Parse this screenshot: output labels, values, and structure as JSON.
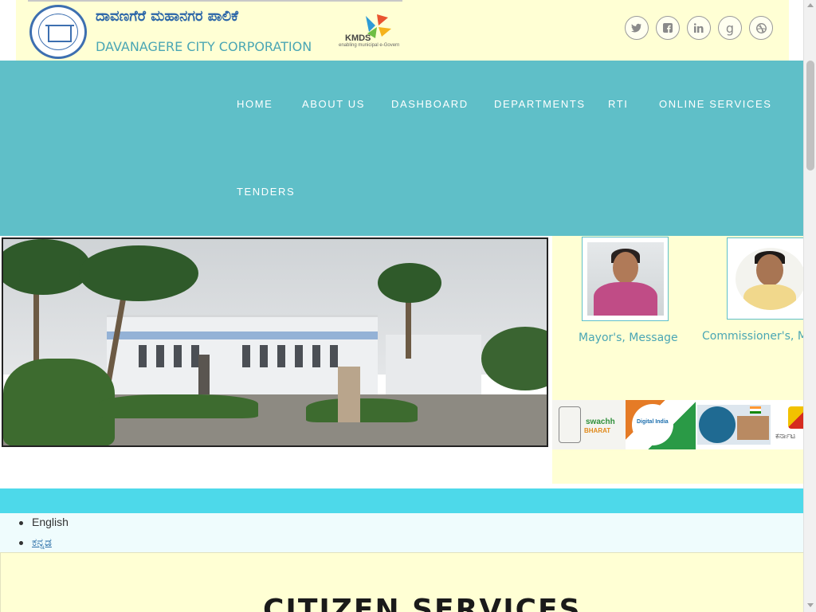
{
  "header": {
    "brand_kannada": "ದಾವಣಗೆರೆ ಮಹಾನಗರ ಪಾಲಿಕೆ",
    "brand_english": "DAVANAGERE CITY CORPORATION",
    "kmds_logo_text": "KMDS",
    "kmds_tagline": "enabling municipal e-Govern",
    "social_icons": [
      "twitter-icon",
      "facebook-icon",
      "linkedin-icon",
      "google-plus-icon",
      "dribbble-icon"
    ]
  },
  "nav": {
    "items": [
      {
        "label": "HOME"
      },
      {
        "label": "ABOUT US"
      },
      {
        "label": "DASHBOARD"
      },
      {
        "label": "DEPARTMENTS"
      },
      {
        "label": "RTI"
      },
      {
        "label": "ONLINE SERVICES"
      },
      {
        "label": "TENDERS"
      }
    ]
  },
  "side": {
    "mayor_caption": "Mayor's, Message",
    "commissioner_caption": "Commissioner's, M",
    "banners": {
      "swachh": "swachh",
      "bharat": "BHARAT",
      "digital_india": "Digital India",
      "karnataka": "ಕರ್ನಾಟ"
    }
  },
  "languages": {
    "items": [
      {
        "label": "English",
        "link": false
      },
      {
        "label": "ಕನ್ನಡ",
        "link": true
      }
    ]
  },
  "citizen_services": {
    "title": "CITIZEN SERVICES"
  },
  "colors": {
    "nav_bg": "#5fbfc8",
    "header_bg": "#ffffd4",
    "cyan_bar": "#4dd9ea",
    "brand_blue": "#2c66a8",
    "caption_teal": "#4aa6b4"
  }
}
